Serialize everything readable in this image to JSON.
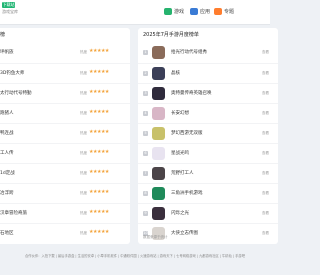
{
  "header": {
    "logo_text": "下载站",
    "logo_sub": "游戏宝库",
    "nav": [
      {
        "label": "游戏",
        "icon": "gamepad-icon",
        "color": "#26b36e"
      },
      {
        "label": "应用",
        "icon": "apps-icon",
        "color": "#3a7bd5"
      },
      {
        "label": "专题",
        "icon": "topic-icon",
        "color": "#ff7d2e"
      }
    ]
  },
  "left_panel": {
    "title": "榜",
    "items": [
      {
        "name": "坪帆族",
        "score": "热度",
        "stars": "★★★★★"
      },
      {
        "name": "3D钓鱼大师",
        "score": "热度",
        "stars": "★★★★★"
      },
      {
        "name": "太行动代号特勤",
        "score": "热度",
        "stars": "★★★★★"
      },
      {
        "name": "跑猪人",
        "score": "热度",
        "stars": "★★★★★"
      },
      {
        "name": "鸭连战",
        "score": "热度",
        "stars": "★★★★★"
      },
      {
        "name": "工人传",
        "score": "热度",
        "stars": "★★★★★"
      },
      {
        "name": "1d定战",
        "score": "热度",
        "stars": "★★★★★"
      },
      {
        "name": "冶浮跨",
        "score": "热度",
        "stars": "★★★★★"
      },
      {
        "name": "汉章冒险奇旅",
        "score": "热度",
        "stars": "★★★★★"
      },
      {
        "name": "石地区",
        "score": "热度",
        "stars": "★★★★★"
      }
    ]
  },
  "right_panel": {
    "title": "2025年7月手游月度榜单",
    "more_label": "查看",
    "items": [
      {
        "rank": "1",
        "name": "拾光行动代号组秀",
        "icon_color": "#8a6b5a"
      },
      {
        "rank": "2",
        "name": "晶核",
        "icon_color": "#3b3f58"
      },
      {
        "rank": "3",
        "name": "奥特曼传奇英雄召唤",
        "icon_color": "#2f2b3c"
      },
      {
        "rank": "4",
        "name": "长安幻想",
        "icon_color": "#d8b6c6"
      },
      {
        "rank": "5",
        "name": "梦幻西游无双版",
        "icon_color": "#c8c16a"
      },
      {
        "rank": "6",
        "name": "星战光鸣",
        "icon_color": "#e8e3f0"
      },
      {
        "rank": "7",
        "name": "荒野打工人",
        "icon_color": "#4b4448"
      },
      {
        "rank": "8",
        "name": "三角洲手机游戏",
        "icon_color": "#1f8a5a"
      },
      {
        "rank": "9",
        "name": "闪烁之光",
        "icon_color": "#3a2f3d"
      },
      {
        "rank": "10",
        "name": "大侠立志传图",
        "icon_color": "#d9d4cf"
      }
    ],
    "footer": "数据来源于统计"
  },
  "footer": {
    "text": "合作伙伴：入拍下载 | 最后手游盒 | 生活的安卓 | 小草手机软件 | 中通软件园 | 火速游戏站 | 游戏天下 | 七号网络游戏 | 九都游戏社区 | 牛精仙 | 手游吧"
  }
}
